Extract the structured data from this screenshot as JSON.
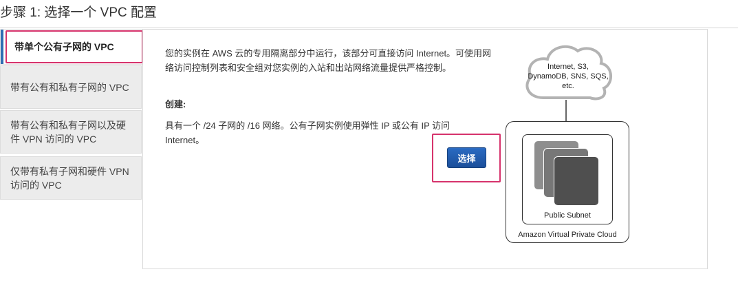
{
  "page": {
    "title": "步骤 1: 选择一个 VPC 配置"
  },
  "sidebar": {
    "items": [
      {
        "label": "带单个公有子网的 VPC",
        "active": true
      },
      {
        "label": "带有公有和私有子网的 VPC",
        "active": false
      },
      {
        "label": "带有公有和私有子网以及硬件 VPN 访问的 VPC",
        "active": false
      },
      {
        "label": "仅带有私有子网和硬件 VPN 访问的 VPC",
        "active": false
      }
    ]
  },
  "main": {
    "description": "您的实例在 AWS 云的专用隔离部分中运行，该部分可直接访问 Internet。可使用网络访问控制列表和安全组对您实例的入站和出站网络流量提供严格控制。",
    "create_label": "创建:",
    "create_detail": "具有一个 /24 子网的 /16 网络。公有子网实例使用弹性 IP 或公有 IP 访问 Internet。",
    "select_button_label": "选择"
  },
  "diagram": {
    "cloud_label": "Internet, S3, DynamoDB, SNS, SQS, etc.",
    "subnet_label": "Public Subnet",
    "vpc_label": "Amazon Virtual Private Cloud"
  },
  "colors": {
    "highlight": "#d6336c",
    "primary_button": "#1f5aa8",
    "active_indicator": "#2f6db3"
  }
}
